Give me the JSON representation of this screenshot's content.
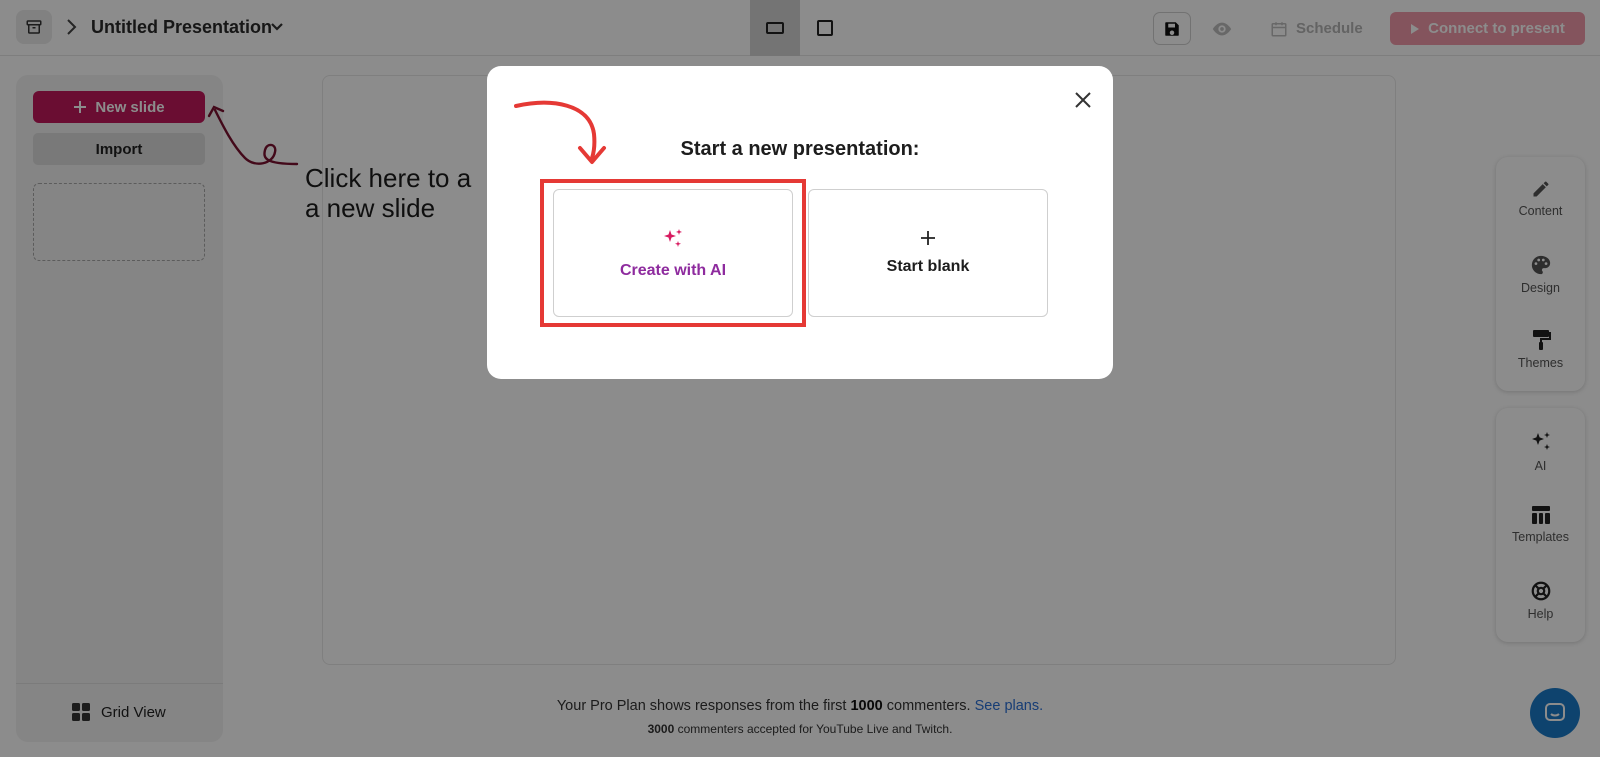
{
  "topbar": {
    "title": "Untitled Presentation",
    "schedule_label": "Schedule",
    "connect_label": "Connect to present"
  },
  "sidebar": {
    "new_slide_label": "New slide",
    "import_label": "Import",
    "grid_view_label": "Grid View"
  },
  "annotation": {
    "line1": "Click here to a",
    "line2": "a new slide"
  },
  "tools": {
    "content": "Content",
    "design": "Design",
    "themes": "Themes",
    "ai": "AI",
    "templates": "Templates",
    "help": "Help"
  },
  "footer": {
    "line1_prefix": "Your Pro Plan shows responses from the first ",
    "line1_count": "1000",
    "line1_suffix": " commenters.",
    "see_plans": "See plans.",
    "line2_count": "3000",
    "line2_suffix": " commenters accepted for YouTube Live and Twitch."
  },
  "modal": {
    "title": "Start a new presentation:",
    "option_ai": "Create with AI",
    "option_blank": "Start blank"
  },
  "colors": {
    "brand": "#c2185b",
    "ai_purple": "#8e2b9e",
    "highlight": "#e53935",
    "link": "#2a6fd6"
  }
}
